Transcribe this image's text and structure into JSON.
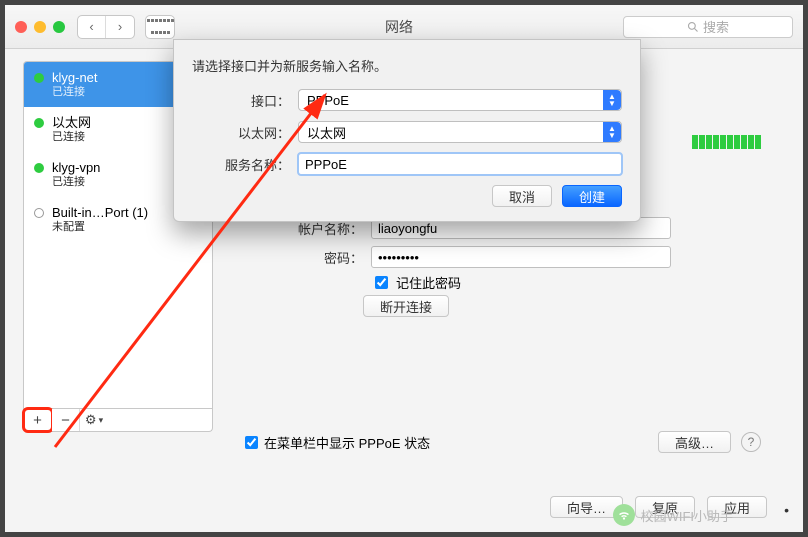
{
  "toolbar": {
    "window_title": "网络",
    "search_placeholder": "搜索"
  },
  "sidebar": {
    "items": [
      {
        "name": "klyg-net",
        "status": "已连接",
        "led": "green"
      },
      {
        "name": "以太网",
        "status": "已连接",
        "led": "green"
      },
      {
        "name": "klyg-vpn",
        "status": "已连接",
        "led": "green"
      },
      {
        "name": "Built-in…Port (1)",
        "status": "未配置",
        "led": "off"
      }
    ],
    "add_label": "+",
    "remove_label": "−",
    "gear_label": "⚙︎"
  },
  "right": {
    "account_label": "帐户名称：",
    "account_value": "liaoyongfu",
    "password_label": "密码：",
    "password_value": "•••••••••",
    "remember_label": "记住此密码",
    "disconnect_label": "断开连接",
    "show_status_label": "在菜单栏中显示 PPPoE 状态",
    "advanced_label": "高级…",
    "help_label": "?"
  },
  "bottom": {
    "wizard_label": "向导…",
    "revert_label": "复原",
    "apply_label": "应用"
  },
  "modal": {
    "title": "请选择接口并为新服务输入名称。",
    "interface_label": "接口：",
    "interface_value": "PPPoE",
    "ethernet_label": "以太网：",
    "ethernet_value": "以太网",
    "service_label": "服务名称：",
    "service_value": "PPPoE",
    "cancel_label": "取消",
    "create_label": "创建"
  },
  "watermark": {
    "text": "校园WIFI小助手"
  },
  "pagedot": "•"
}
